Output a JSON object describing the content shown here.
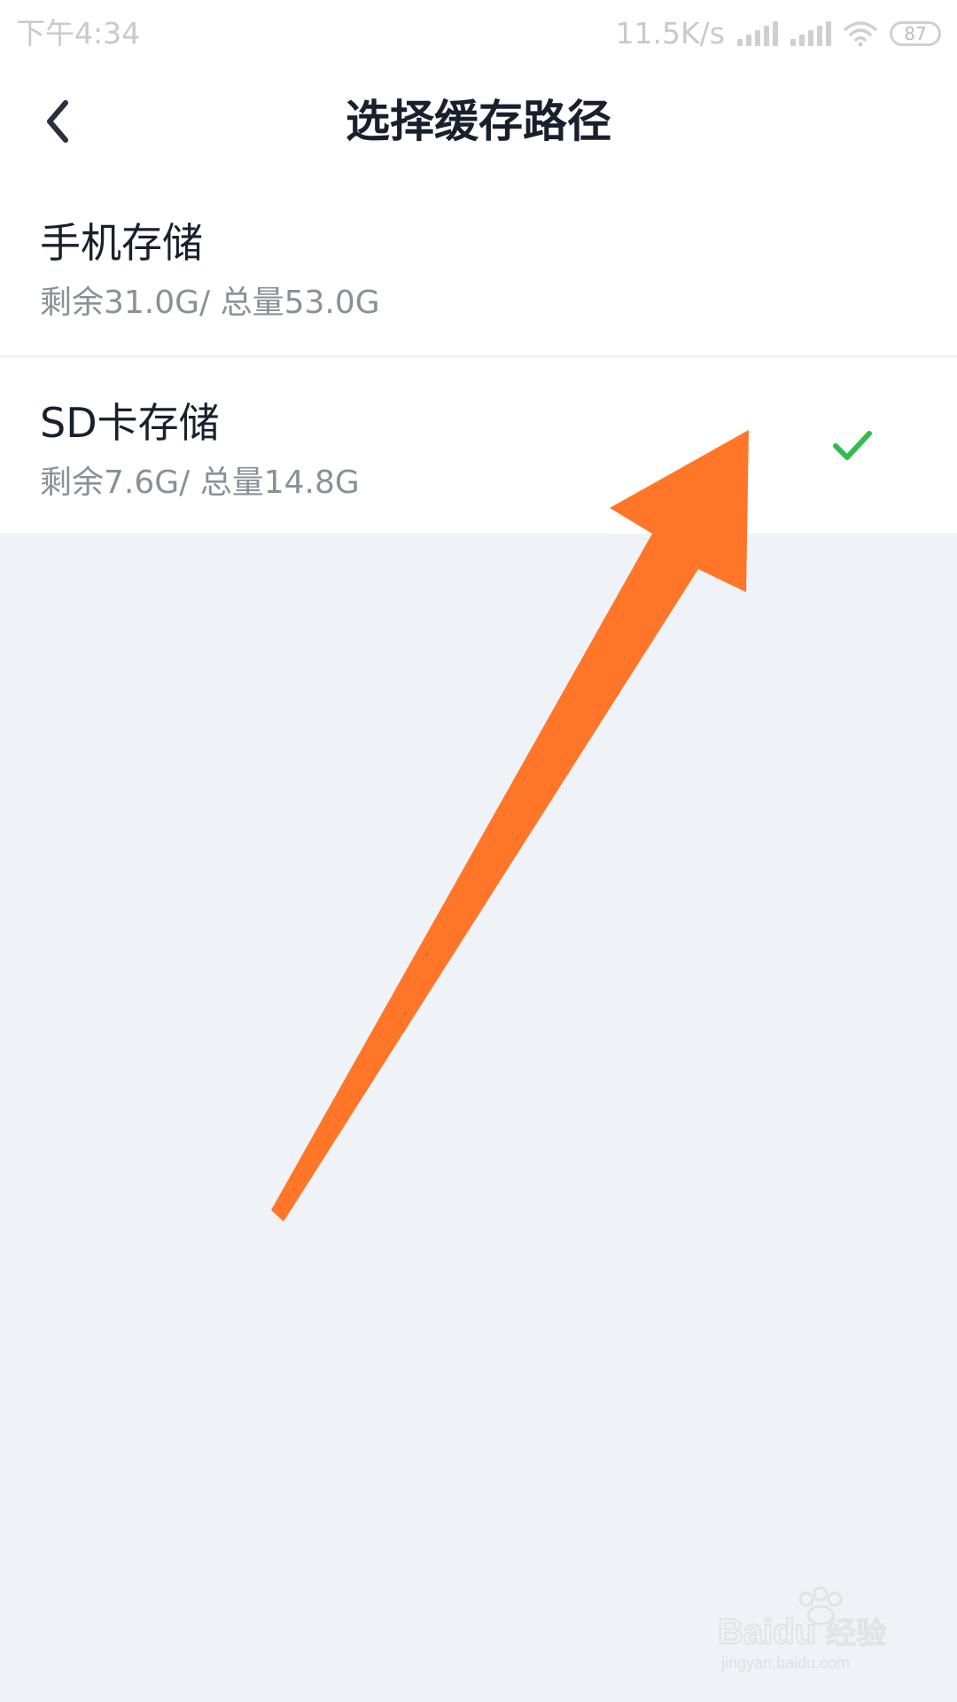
{
  "status_bar": {
    "time": "下午4:34",
    "network_speed": "11.5K/s",
    "battery": "87",
    "icons": [
      "signal-icon",
      "signal-icon",
      "wifi-icon",
      "battery-icon"
    ]
  },
  "header": {
    "title": "选择缓存路径",
    "back_icon": "chevron-left-icon"
  },
  "storage_options": [
    {
      "title": "手机存储",
      "detail": "剩余31.0G/ 总量53.0G",
      "selected": false
    },
    {
      "title": "SD卡存储",
      "detail": "剩余7.6G/ 总量14.8G",
      "selected": true,
      "indicator_icon": "check-icon"
    }
  ],
  "colors": {
    "accent_check": "#2fbd4e",
    "annotation_arrow": "#ff7628",
    "background": "#eff2f7",
    "title_text": "#1a1f2e",
    "secondary_text": "#8a8f99"
  },
  "watermark": {
    "brand": "Baidu经验",
    "domain": "jingyan.baidu.com"
  }
}
